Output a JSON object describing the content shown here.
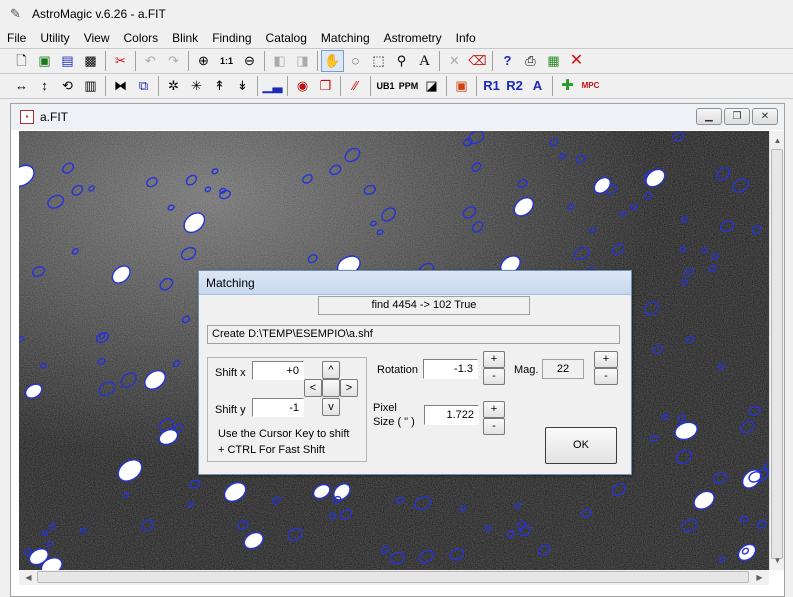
{
  "app": {
    "title": "AstroMagic v.6.26 - a.FIT"
  },
  "menu": [
    "File",
    "Utility",
    "View",
    "Colors",
    "Blink",
    "Finding",
    "Catalog",
    "Matching",
    "Astrometry",
    "Info"
  ],
  "toolbar1": {
    "icons": [
      "new-file-icon",
      "open-file-icon",
      "save-file-icon",
      "image-properties-icon",
      "cut-icon",
      "undo-icon",
      "redo-icon",
      "zoom-in-icon",
      "zoom-1-1-icon",
      "zoom-out-icon",
      "previous-frame-icon",
      "next-frame-icon",
      "hand-pan-icon",
      "lasso-select-icon",
      "rect-select-icon",
      "magnifier-icon",
      "text-tool-icon",
      "disabled-tool-icon",
      "eraser-icon",
      "help-icon",
      "print-icon",
      "grid-icon",
      "close-icon"
    ]
  },
  "toolbar2": {
    "icons": [
      "flip-horizontal-icon",
      "flip-vertical-icon",
      "rotate-icon",
      "calculator-icon",
      "align-icon",
      "stack-icon",
      "star-detect-icon",
      "star-detect-2-icon",
      "star-up-icon",
      "star-down-icon",
      "histogram-icon",
      "eye-all-icon",
      "copy-frame-icon",
      "dashed-tool-icon",
      "ub1-tool-icon",
      "ppm-tool-icon",
      "dark-frame-icon",
      "marker-icon",
      "r1-icon",
      "r2-icon",
      "font-a-icon",
      "crosshair-icon",
      "mpc-icon"
    ],
    "labels": {
      "ub1": "UB1",
      "ppm": "PPM",
      "r1": "R1",
      "r2": "R2",
      "a": "A",
      "mpc": "MPC"
    }
  },
  "child": {
    "title": "a.FIT"
  },
  "dialog": {
    "title": "Matching",
    "find_status": "find  4454  ->  102 True",
    "create_path": "Create D:\\TEMP\\ESEMPIO\\a.shf",
    "shift_x_label": "Shift x",
    "shift_x_value": "+0",
    "shift_y_label": "Shift y",
    "shift_y_value": "-1",
    "hint_line1": "Use the Cursor Key to shift",
    "hint_line2": "+ CTRL For Fast Shift",
    "rotation_label": "Rotation",
    "rotation_value": "-1.3",
    "mag_label": "Mag.",
    "mag_value": "22",
    "pixel_label_1": "Pixel",
    "pixel_label_2": "Size ( \" )",
    "pixel_value": "1.722",
    "ok_label": "OK",
    "plus": "+",
    "minus": "-",
    "arrow_up": "^",
    "arrow_down": "v",
    "arrow_left": "<",
    "arrow_right": ">"
  },
  "colors": {
    "overlay": "#2633d6",
    "dialog_border": "#6f8fb8"
  }
}
